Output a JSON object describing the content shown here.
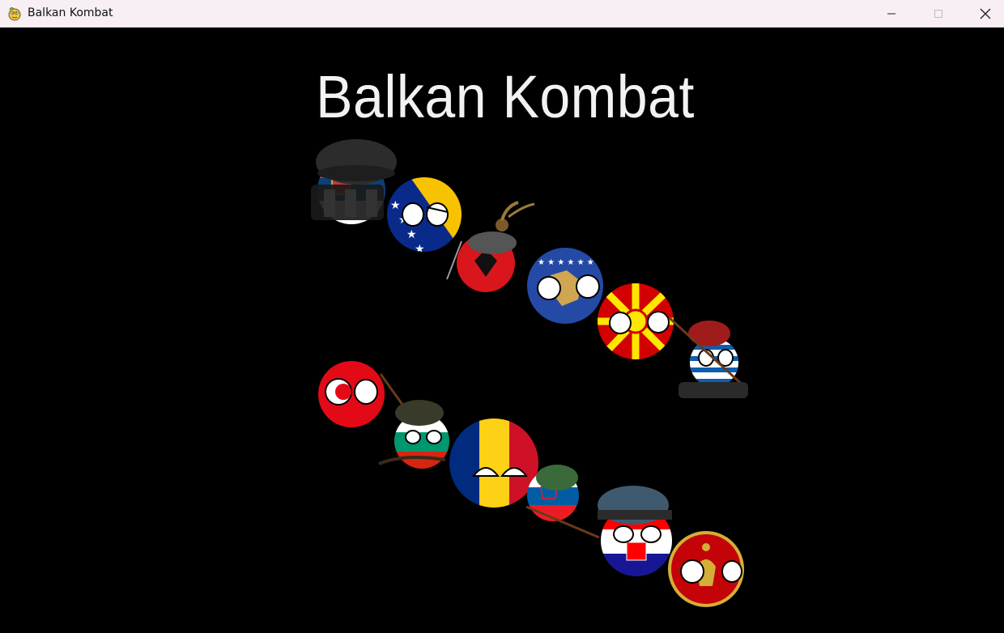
{
  "window": {
    "title": "Balkan Kombat",
    "controls": {
      "minimize": "minimize-icon",
      "maximize": "maximize-icon",
      "close": "close-icon"
    }
  },
  "game": {
    "title": "Balkan Kombat",
    "title_color": "#f2f2f2",
    "background": "#000000",
    "characters": [
      "serbia-ball",
      "bosnia-ball",
      "albania-ball",
      "kosovo-ball",
      "north-macedonia-ball",
      "greece-ball",
      "turkey-ball",
      "bulgaria-ball",
      "romania-ball",
      "slovenia-ball",
      "croatia-ball",
      "montenegro-ball"
    ]
  }
}
